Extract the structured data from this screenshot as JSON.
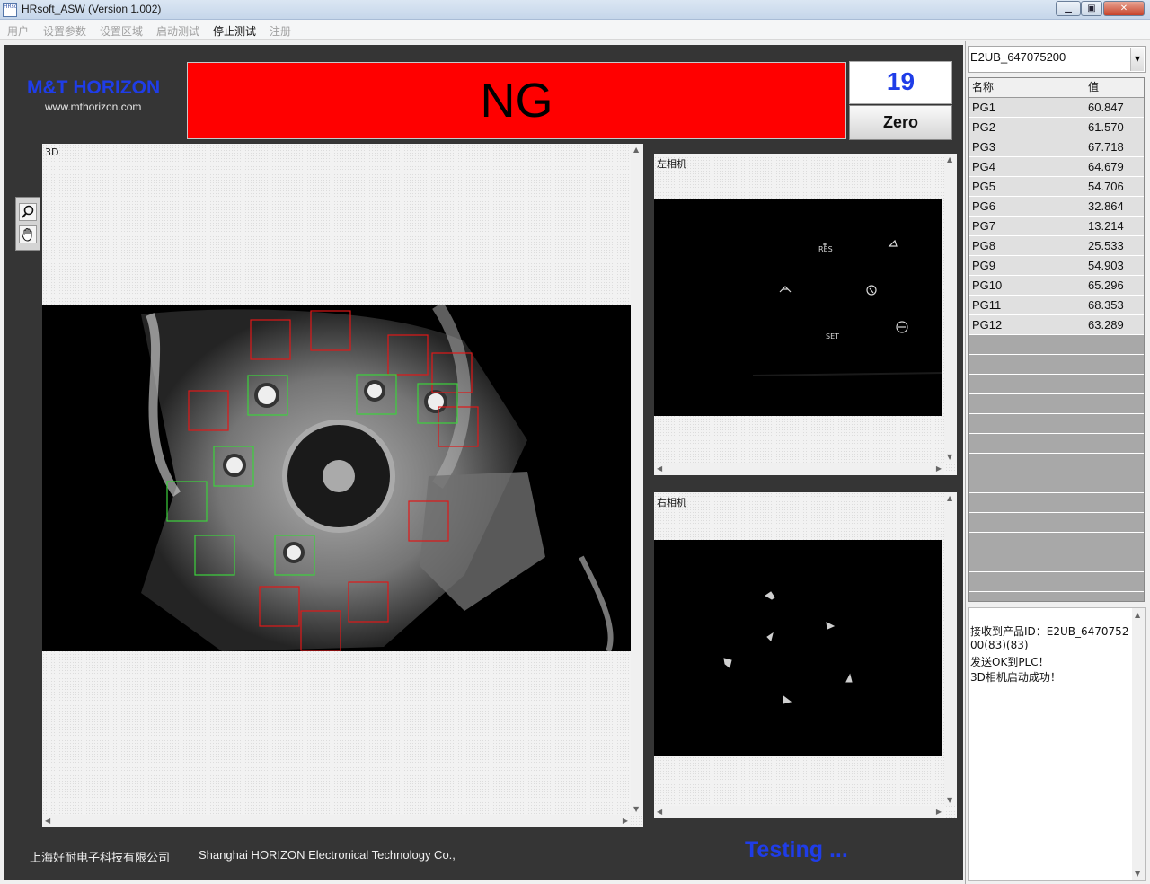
{
  "window": {
    "title": "HRsoft_ASW (Version 1.002)",
    "icon_text": "HRsoft",
    "controls": [
      "minimize",
      "maximize",
      "close"
    ]
  },
  "menu": {
    "items": [
      "用户",
      "设置参数",
      "设置区域",
      "启动测试",
      "停止测试",
      "注册"
    ],
    "active_index": 4
  },
  "brand": {
    "name": "M&T HORIZON",
    "url": "www.mthorizon.com",
    "color": "#1f3de8"
  },
  "result": {
    "status": "NG",
    "status_color": "#ff0000",
    "count": "19",
    "zero_label": "Zero"
  },
  "tools": {
    "zoom_icon": "magnifier-icon",
    "pan_icon": "hand-icon"
  },
  "views": {
    "view3d_label": "3D",
    "left_camera_label": "左相机",
    "right_camera_label": "右相机",
    "left_camera_marks": [
      "RES",
      "SET"
    ]
  },
  "footer": {
    "company_cn": "上海好耐电子科技有限公司",
    "company_en": "Shanghai HORIZON Electronical Technology Co.,",
    "status_text": "Testing ..."
  },
  "product": {
    "selected_id": "E2UB_647075200"
  },
  "table": {
    "columns": [
      "名称",
      "值"
    ],
    "rows": [
      [
        "PG1",
        "60.847"
      ],
      [
        "PG2",
        "61.570"
      ],
      [
        "PG3",
        "67.718"
      ],
      [
        "PG4",
        "64.679"
      ],
      [
        "PG5",
        "54.706"
      ],
      [
        "PG6",
        "32.864"
      ],
      [
        "PG7",
        "13.214"
      ],
      [
        "PG8",
        "25.533"
      ],
      [
        "PG9",
        "54.903"
      ],
      [
        "PG10",
        "65.296"
      ],
      [
        "PG11",
        "68.353"
      ],
      [
        "PG12",
        "63.289"
      ]
    ]
  },
  "log": {
    "lines": [
      "接收到产品ID：E2UB_6470752",
      "00(83)(83)",
      "发送OK到PLC！",
      "3D相机启动成功！"
    ]
  }
}
